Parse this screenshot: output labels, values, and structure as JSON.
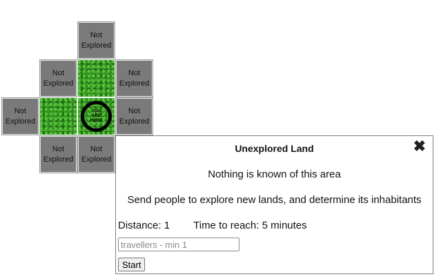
{
  "map": {
    "unexplored_label": "Not\nExplored",
    "current_marker": "YOU\nARE\nHERE"
  },
  "dialog": {
    "title": "Unexplored Land",
    "close_glyph": "✖",
    "description": "Nothing is known of this area",
    "instruction": "Send people to explore new lands, and determine its inhabitants",
    "distance_label": "Distance:",
    "distance_value": "1",
    "time_label": "Time to reach:",
    "time_value": "5 minutes",
    "travellers_placeholder": "travellers - min 1",
    "start_label": "Start"
  }
}
